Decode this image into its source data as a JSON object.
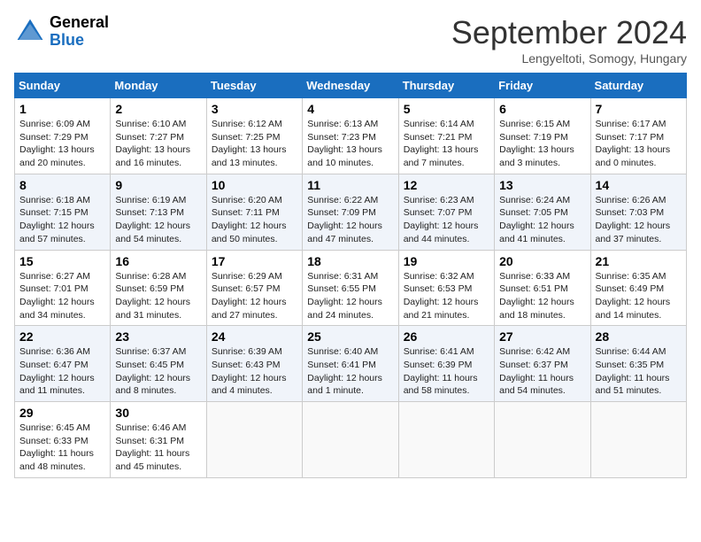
{
  "header": {
    "logo_general": "General",
    "logo_blue": "Blue",
    "title": "September 2024",
    "location": "Lengyeltoti, Somogy, Hungary"
  },
  "days_of_week": [
    "Sunday",
    "Monday",
    "Tuesday",
    "Wednesday",
    "Thursday",
    "Friday",
    "Saturday"
  ],
  "weeks": [
    [
      {
        "day": "1",
        "sunrise": "6:09 AM",
        "sunset": "7:29 PM",
        "daylight": "13 hours and 20 minutes."
      },
      {
        "day": "2",
        "sunrise": "6:10 AM",
        "sunset": "7:27 PM",
        "daylight": "13 hours and 16 minutes."
      },
      {
        "day": "3",
        "sunrise": "6:12 AM",
        "sunset": "7:25 PM",
        "daylight": "13 hours and 13 minutes."
      },
      {
        "day": "4",
        "sunrise": "6:13 AM",
        "sunset": "7:23 PM",
        "daylight": "13 hours and 10 minutes."
      },
      {
        "day": "5",
        "sunrise": "6:14 AM",
        "sunset": "7:21 PM",
        "daylight": "13 hours and 7 minutes."
      },
      {
        "day": "6",
        "sunrise": "6:15 AM",
        "sunset": "7:19 PM",
        "daylight": "13 hours and 3 minutes."
      },
      {
        "day": "7",
        "sunrise": "6:17 AM",
        "sunset": "7:17 PM",
        "daylight": "13 hours and 0 minutes."
      }
    ],
    [
      {
        "day": "8",
        "sunrise": "6:18 AM",
        "sunset": "7:15 PM",
        "daylight": "12 hours and 57 minutes."
      },
      {
        "day": "9",
        "sunrise": "6:19 AM",
        "sunset": "7:13 PM",
        "daylight": "12 hours and 54 minutes."
      },
      {
        "day": "10",
        "sunrise": "6:20 AM",
        "sunset": "7:11 PM",
        "daylight": "12 hours and 50 minutes."
      },
      {
        "day": "11",
        "sunrise": "6:22 AM",
        "sunset": "7:09 PM",
        "daylight": "12 hours and 47 minutes."
      },
      {
        "day": "12",
        "sunrise": "6:23 AM",
        "sunset": "7:07 PM",
        "daylight": "12 hours and 44 minutes."
      },
      {
        "day": "13",
        "sunrise": "6:24 AM",
        "sunset": "7:05 PM",
        "daylight": "12 hours and 41 minutes."
      },
      {
        "day": "14",
        "sunrise": "6:26 AM",
        "sunset": "7:03 PM",
        "daylight": "12 hours and 37 minutes."
      }
    ],
    [
      {
        "day": "15",
        "sunrise": "6:27 AM",
        "sunset": "7:01 PM",
        "daylight": "12 hours and 34 minutes."
      },
      {
        "day": "16",
        "sunrise": "6:28 AM",
        "sunset": "6:59 PM",
        "daylight": "12 hours and 31 minutes."
      },
      {
        "day": "17",
        "sunrise": "6:29 AM",
        "sunset": "6:57 PM",
        "daylight": "12 hours and 27 minutes."
      },
      {
        "day": "18",
        "sunrise": "6:31 AM",
        "sunset": "6:55 PM",
        "daylight": "12 hours and 24 minutes."
      },
      {
        "day": "19",
        "sunrise": "6:32 AM",
        "sunset": "6:53 PM",
        "daylight": "12 hours and 21 minutes."
      },
      {
        "day": "20",
        "sunrise": "6:33 AM",
        "sunset": "6:51 PM",
        "daylight": "12 hours and 18 minutes."
      },
      {
        "day": "21",
        "sunrise": "6:35 AM",
        "sunset": "6:49 PM",
        "daylight": "12 hours and 14 minutes."
      }
    ],
    [
      {
        "day": "22",
        "sunrise": "6:36 AM",
        "sunset": "6:47 PM",
        "daylight": "12 hours and 11 minutes."
      },
      {
        "day": "23",
        "sunrise": "6:37 AM",
        "sunset": "6:45 PM",
        "daylight": "12 hours and 8 minutes."
      },
      {
        "day": "24",
        "sunrise": "6:39 AM",
        "sunset": "6:43 PM",
        "daylight": "12 hours and 4 minutes."
      },
      {
        "day": "25",
        "sunrise": "6:40 AM",
        "sunset": "6:41 PM",
        "daylight": "12 hours and 1 minute."
      },
      {
        "day": "26",
        "sunrise": "6:41 AM",
        "sunset": "6:39 PM",
        "daylight": "11 hours and 58 minutes."
      },
      {
        "day": "27",
        "sunrise": "6:42 AM",
        "sunset": "6:37 PM",
        "daylight": "11 hours and 54 minutes."
      },
      {
        "day": "28",
        "sunrise": "6:44 AM",
        "sunset": "6:35 PM",
        "daylight": "11 hours and 51 minutes."
      }
    ],
    [
      {
        "day": "29",
        "sunrise": "6:45 AM",
        "sunset": "6:33 PM",
        "daylight": "11 hours and 48 minutes."
      },
      {
        "day": "30",
        "sunrise": "6:46 AM",
        "sunset": "6:31 PM",
        "daylight": "11 hours and 45 minutes."
      },
      null,
      null,
      null,
      null,
      null
    ]
  ],
  "labels": {
    "sunrise": "Sunrise:",
    "sunset": "Sunset:",
    "daylight": "Daylight:"
  }
}
